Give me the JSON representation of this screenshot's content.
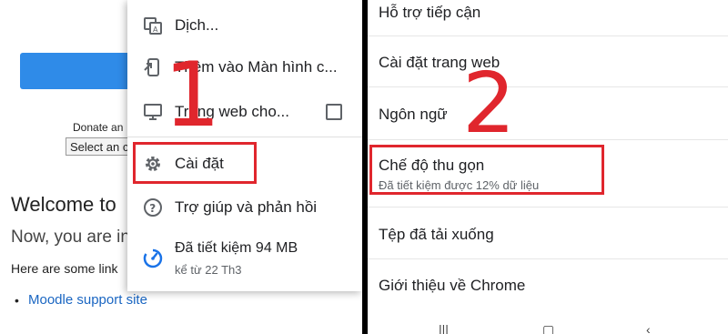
{
  "background_page": {
    "donate_text": "Donate an",
    "select_text": "Select an c",
    "welcome_text": "Welcome to",
    "now_text": "Now, you are in",
    "here_text": "Here are some link",
    "link_text": "Moodle support site"
  },
  "menu": {
    "items": [
      {
        "label": "Dịch..."
      },
      {
        "label": "Thêm vào Màn hình c..."
      },
      {
        "label": "Trang web cho..."
      },
      {
        "label": "Cài đặt"
      },
      {
        "label": "Trợ giúp và phản hồi"
      }
    ],
    "saved_title": "Đã tiết kiệm 94 MB",
    "saved_sub": "kể từ 22 Th3"
  },
  "annotations": {
    "step1": "1",
    "step2": "2",
    "color": "#e0262d"
  },
  "settings": {
    "items": [
      {
        "label": "Hỗ trợ tiếp cận"
      },
      {
        "label": "Cài đặt trang web"
      },
      {
        "label": "Ngôn ngữ"
      },
      {
        "label": "Chế độ thu gọn",
        "sub": "Đã tiết kiệm được 12% dữ liệu"
      },
      {
        "label": "Tệp đã tải xuống"
      },
      {
        "label": "Giới thiệu về Chrome"
      }
    ]
  }
}
